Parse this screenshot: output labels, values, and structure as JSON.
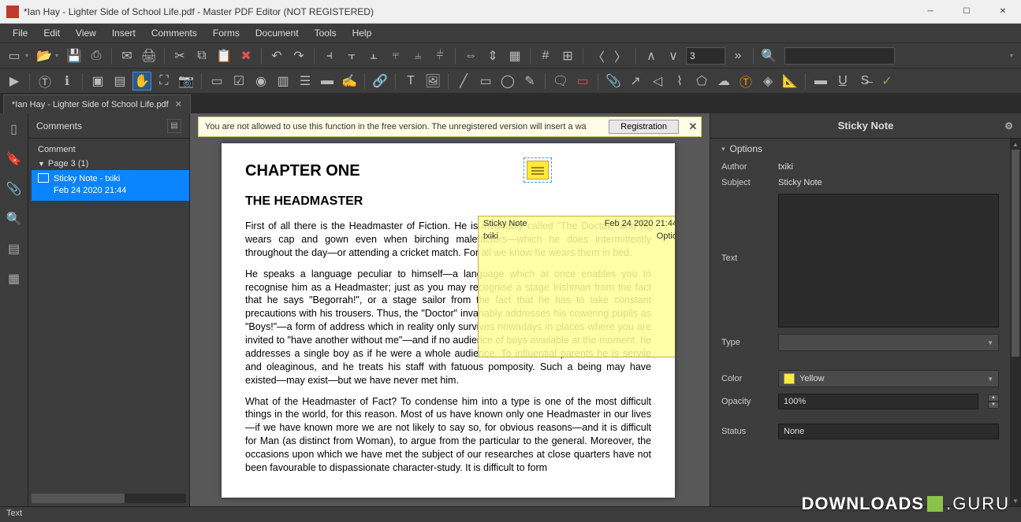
{
  "window": {
    "title": "*Ian Hay - Lighter Side of School Life.pdf - Master PDF Editor (NOT REGISTERED)"
  },
  "menu": [
    "File",
    "Edit",
    "View",
    "Insert",
    "Comments",
    "Forms",
    "Document",
    "Tools",
    "Help"
  ],
  "toolbar": {
    "page_number": "3",
    "search_placeholder": ""
  },
  "tab": {
    "label": "*Ian Hay - Lighter Side of School Life.pdf"
  },
  "comments_panel": {
    "title": "Comments",
    "section": "Comment",
    "page_label": "Page 3 (1)",
    "item_title": "Sticky Note - txiki",
    "item_date": "Feb 24 2020 21:44"
  },
  "banner": {
    "text": "You are not allowed to use this function in the free version.   The unregistered version will insert a wa",
    "button": "Registration"
  },
  "document": {
    "chapter": "CHAPTER ONE",
    "heading": "THE HEADMASTER",
    "p1": "First of all there is the Headmaster of Fiction. He is invariably called \"The Doctor,\" and he wears cap and gown even when birching malefactors—which he does intermittently throughout the day—or attending a cricket match. For all we know he wears them in bed.",
    "p2": "He speaks a language peculiar to himself—a language which at once enables you to recognise him as a Headmaster; just as you may recognise a stage Irishman from the fact that he says \"Begorrah!\", or a stage sailor from the fact that he has to take constant precautions with his trousers. Thus, the \"Doctor\" invariably addresses his cowering pupils as \"Boys!\"—a form of address which in reality only survives nowadays in places where you are invited to \"have another without me\"—and if no audience of boys available at the moment, he addresses a single boy as if he were a whole audience. To influential parents he is servile and oleaginous, and he treats his staff with fatuous pomposity. Such a being may have existed—may exist—but we have never met him.",
    "p3": "What of the Headmaster of Fact? To condense him into a type is one of the most difficult things in the world, for this reason. Most of us have known only one Headmaster in our lives—if we have known more we are not likely to say so, for obvious reasons—and it is difficult for Man (as distinct from Woman), to argue from the particular to the general. Moreover, the occasions upon which we have met the subject of our researches at close quarters have not been favourable to dispassionate character-study. It is difficult to form"
  },
  "sticky_popup": {
    "title": "Sticky Note",
    "date": "Feb 24 2020 21:44",
    "author": "txiki",
    "options": "Optio"
  },
  "right_panel": {
    "title": "Sticky Note",
    "options_label": "Options",
    "author_label": "Author",
    "author_value": "txiki",
    "subject_label": "Subject",
    "subject_value": "Sticky Note",
    "text_label": "Text",
    "type_label": "Type",
    "color_label": "Color",
    "color_value": "Yellow",
    "opacity_label": "Opacity",
    "opacity_value": "100%",
    "status_label": "Status",
    "status_value": "None"
  },
  "statusbar": {
    "text": "Text"
  },
  "watermark": {
    "part1": "DOWNLOADS",
    "part2": ".GURU"
  }
}
